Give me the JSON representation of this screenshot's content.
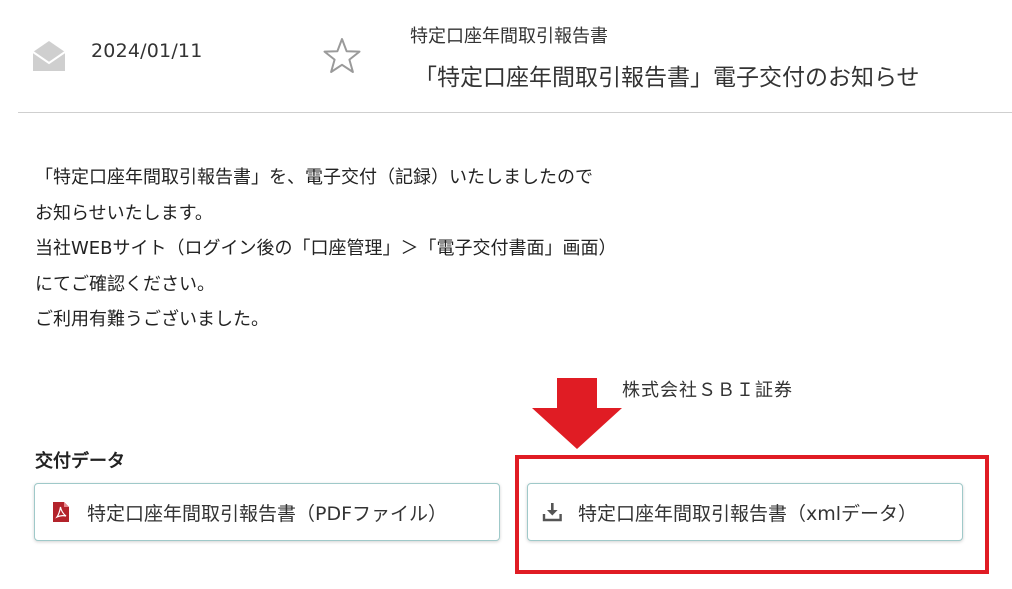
{
  "header": {
    "date": "2024/01/11",
    "category": "特定口座年間取引報告書",
    "subject": "「特定口座年間取引報告書」電子交付のお知らせ"
  },
  "message": {
    "lines": [
      "「特定口座年間取引報告書」を、電子交付（記録）いたしましたので",
      "お知らせいたします。",
      "当社WEBサイト（ログイン後の「口座管理」＞「電子交付書面」画面）",
      "にてご確認ください。",
      "ご利用有難うございました。"
    ],
    "signature": "株式会社ＳＢＩ証券"
  },
  "attachments": {
    "heading": "交付データ",
    "pdf_label": "特定口座年間取引報告書（PDFファイル）",
    "xml_label": "特定口座年間取引報告書（xmlデータ）"
  },
  "icons": {
    "mail": "envelope-icon",
    "star": "star-icon",
    "pdf": "pdf-file-icon",
    "download": "download-icon"
  },
  "colors": {
    "annotation_red": "#e01c24",
    "pdf_icon": "#b3232b",
    "button_border": "#9fc9c9",
    "icon_gray": "#cfcfcf"
  }
}
